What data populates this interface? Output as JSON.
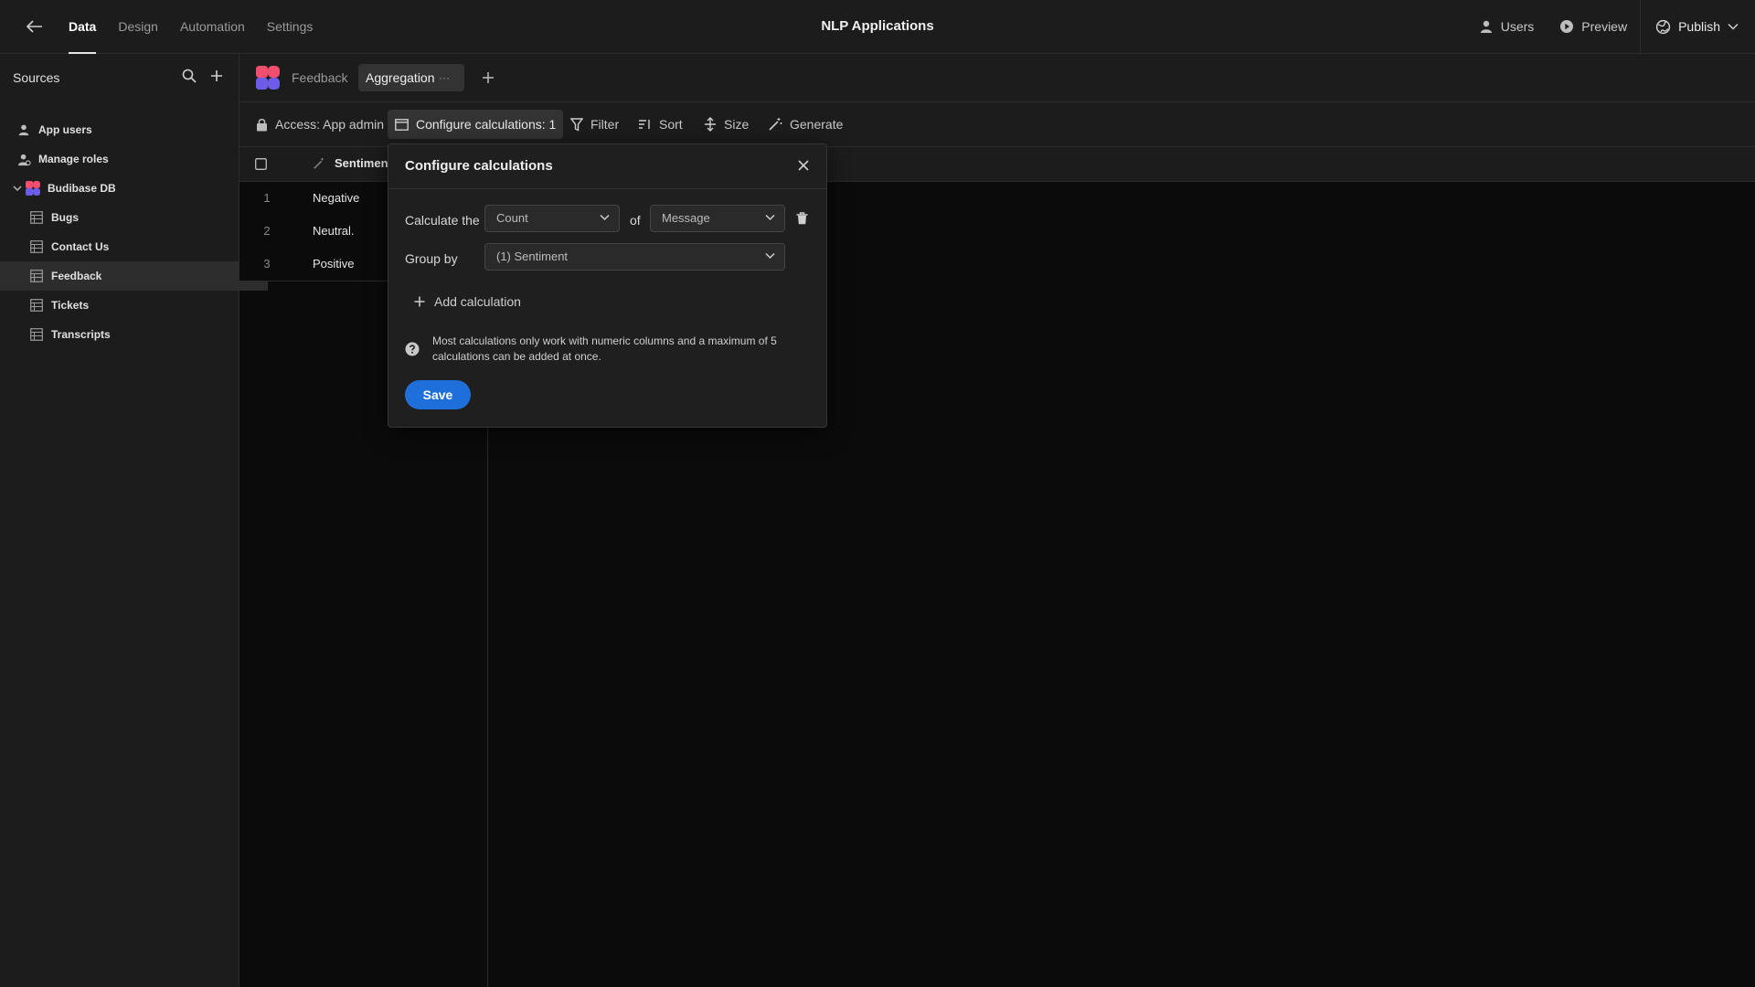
{
  "topbar": {
    "nav": [
      "Data",
      "Design",
      "Automation",
      "Settings"
    ],
    "active_nav": "Data",
    "app_title": "NLP Applications",
    "users_label": "Users",
    "preview_label": "Preview",
    "publish_label": "Publish"
  },
  "sidebar": {
    "title": "Sources",
    "items": [
      {
        "label": "App users",
        "icon": "user-icon"
      },
      {
        "label": "Manage roles",
        "icon": "roles-icon"
      },
      {
        "label": "Budibase DB",
        "icon": "budibase-logo-icon"
      },
      {
        "label": "Bugs",
        "icon": "table-icon"
      },
      {
        "label": "Contact Us",
        "icon": "table-icon"
      },
      {
        "label": "Feedback",
        "icon": "table-icon",
        "selected": true
      },
      {
        "label": "Tickets",
        "icon": "table-icon"
      },
      {
        "label": "Transcripts",
        "icon": "table-icon"
      }
    ]
  },
  "tabs": {
    "items": [
      "Feedback",
      "Aggregation"
    ],
    "active": "Aggregation",
    "more_label": "···"
  },
  "toolbar": {
    "access": "Access: App admin",
    "configure": "Configure calculations: 1",
    "filter": "Filter",
    "sort": "Sort",
    "size": "Size",
    "generate": "Generate"
  },
  "grid": {
    "column": "Sentimen",
    "rows": [
      {
        "num": "1",
        "value": "Negative"
      },
      {
        "num": "2",
        "value": "Neutral."
      },
      {
        "num": "3",
        "value": "Positive"
      }
    ]
  },
  "popover": {
    "title": "Configure calculations",
    "calculate_label": "Calculate the",
    "calc_value": "Count",
    "of_label": "of",
    "field_value": "Message",
    "group_label": "Group by",
    "group_value": "(1) Sentiment",
    "add_label": "Add calculation",
    "info": "Most calculations only work with numeric columns and a maximum of 5 calculations can be added at once.",
    "save": "Save"
  },
  "colors": {
    "accent": "#1e6fd9",
    "background": "#0b0b0b",
    "panel": "#1c1c1c"
  }
}
